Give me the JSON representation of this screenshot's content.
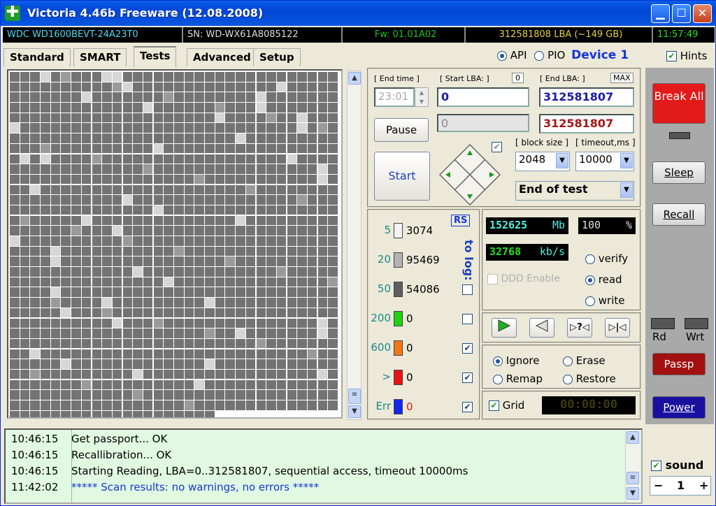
{
  "title": "Victoria 4.46b Freeware (12.08.2008)",
  "infobar": {
    "model": "WDC WD1600BEVT-24A23T0",
    "serial": "SN: WD-WX61A8085122",
    "firmware": "Fw: 01.01A02",
    "lba": "312581808 LBA (~149 GB)",
    "clock": "11:57:49"
  },
  "tabs": [
    "Standard",
    "SMART",
    "Tests",
    "Advanced",
    "Setup"
  ],
  "interface": {
    "api": "API",
    "pio": "PIO",
    "device": "Device 1",
    "hints": "Hints"
  },
  "test": {
    "end_time_label": "[ End time ]",
    "end_time": "23:01",
    "start_lba_label": "[ Start LBA: ]",
    "start_lba_zero": "0",
    "start_lba": "0",
    "current_lba": "0",
    "end_lba_label": "[ End LBA: ]",
    "end_lba_max": "MAX",
    "end_lba": "312581807",
    "end_lba2": "312581807",
    "pause": "Pause",
    "start": "Start",
    "block_size_label": "[ block size ]",
    "block_size": "2048",
    "timeout_label": "[ timeout,ms ]",
    "timeout": "10000",
    "end_action": "End of test"
  },
  "timings": {
    "rs": "RS",
    "to_log": "to log:",
    "rows": [
      {
        "label": "5",
        "count": "3074",
        "color": "#f4f4f4"
      },
      {
        "label": "20",
        "count": "95469",
        "color": "#b3b3b3"
      },
      {
        "label": "50",
        "count": "54086",
        "color": "#5e5e5e"
      },
      {
        "label": "200",
        "count": "0",
        "color": "#22d014"
      },
      {
        "label": "600",
        "count": "0",
        "color": "#f07818"
      },
      {
        "label": ">",
        "count": "0",
        "color": "#e51313"
      },
      {
        "label": "Err",
        "count": "0",
        "color": "#1426e8"
      }
    ]
  },
  "stats": {
    "mb": "152625",
    "mb_unit": "Mb",
    "percent": "100",
    "percent_unit": "%",
    "speed": "32768",
    "speed_unit": "kb/s",
    "ddd": "DDD Enable"
  },
  "mode": {
    "verify": "verify",
    "read": "read",
    "write": "write"
  },
  "action": {
    "ignore": "Ignore",
    "erase": "Erase",
    "remap": "Remap",
    "restore": "Restore"
  },
  "grid_label": "Grid",
  "timer": "00:00:00",
  "side": {
    "break": "Break All",
    "sleep": "Sleep",
    "recall": "Recall",
    "rd": "Rd",
    "wrt": "Wrt",
    "passp": "Passp",
    "power": "Power",
    "sound": "sound",
    "sound_value": "1"
  },
  "log": [
    {
      "time": "10:46:15",
      "msg": "Get passport... OK"
    },
    {
      "time": "10:46:15",
      "msg": "Recallibration... OK"
    },
    {
      "time": "10:46:15",
      "msg": "Starting Reading, LBA=0..312581807, sequential access, timeout 10000ms"
    },
    {
      "time": "11:42:02",
      "msg": "***** Scan results: no warnings, no errors *****"
    }
  ],
  "colors": {
    "titlebar": "#0a56e0",
    "window": "#ece9d8",
    "log_bg": "#e1f9e1",
    "lcd_cyan": "#4ef0e0",
    "lcd_green": "#22e022"
  }
}
